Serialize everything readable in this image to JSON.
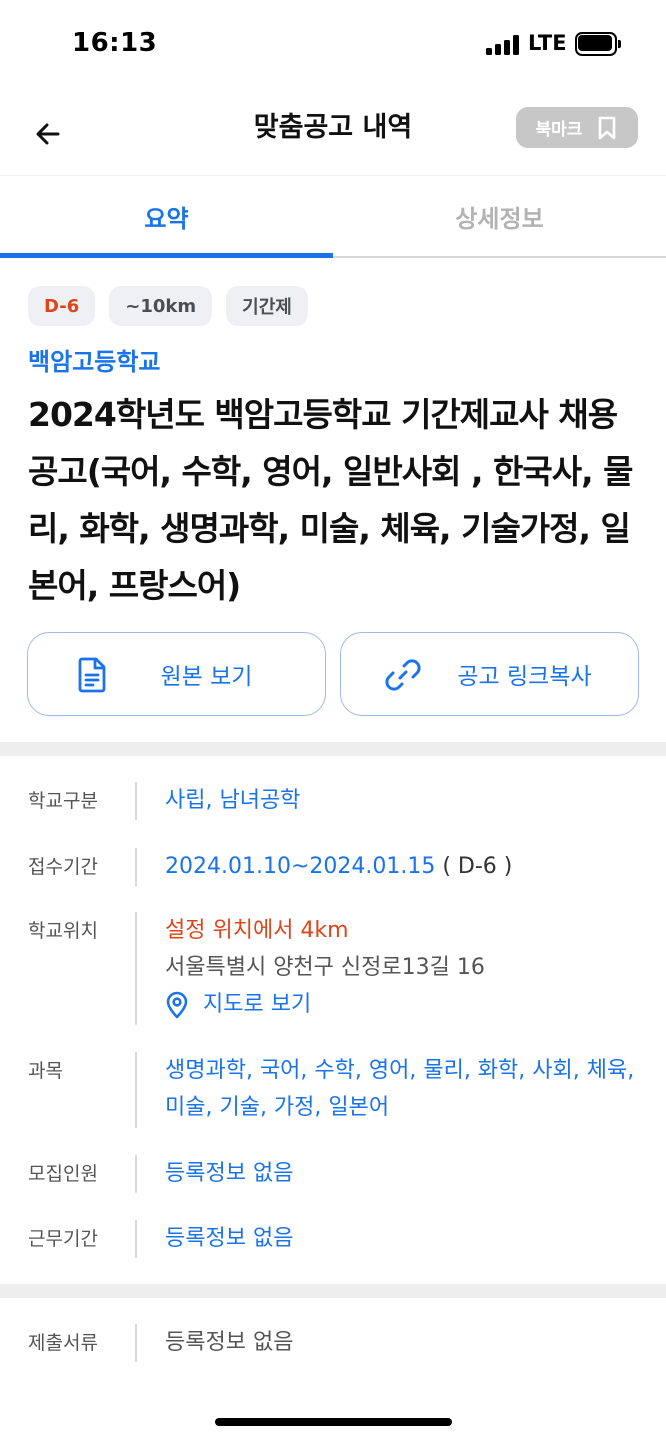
{
  "status": {
    "time": "16:13",
    "network": "LTE"
  },
  "header": {
    "title": "맞춤공고 내역",
    "bookmark_label": "북마크"
  },
  "tabs": [
    {
      "label": "요약",
      "active": true
    },
    {
      "label": "상세정보",
      "active": false
    }
  ],
  "chips": [
    "D-6",
    "~10km",
    "기간제"
  ],
  "post": {
    "school": "백암고등학교",
    "title": "2024학년도 백암고등학교 기간제교사 채용 공고(국어, 수학, 영어, 일반사회 , 한국사, 물리, 화학, 생명과학, 미술, 체육, 기술가정, 일본어, 프랑스어)"
  },
  "actions": {
    "view_original": "원본 보기",
    "copy_link": "공고 링크복사"
  },
  "info": {
    "school_type": {
      "label": "학교구분",
      "value": "사립, 남녀공학"
    },
    "period": {
      "label": "접수기간",
      "dates": "2024.01.10~2024.01.15",
      "dday": " ( D-6 )"
    },
    "location": {
      "label": "학교위치",
      "distance": "설정 위치에서 4km",
      "address": "서울특별시 양천구 신정로13길 16",
      "map_link": "지도로 보기"
    },
    "subjects": {
      "label": "과목",
      "value": "생명과학, 국어, 수학, 영어, 물리, 화학, 사회, 체육, 미술, 기술, 가정, 일본어"
    },
    "recruit": {
      "label": "모집인원",
      "value": "등록정보 없음"
    },
    "work_period": {
      "label": "근무기간",
      "value": "등록정보 없음"
    },
    "documents": {
      "label": "제출서류",
      "value": "등록정보 없음"
    }
  },
  "colors": {
    "accent": "#1a73e8",
    "warning": "#e0441a",
    "inactive": "#b3b3b3"
  }
}
